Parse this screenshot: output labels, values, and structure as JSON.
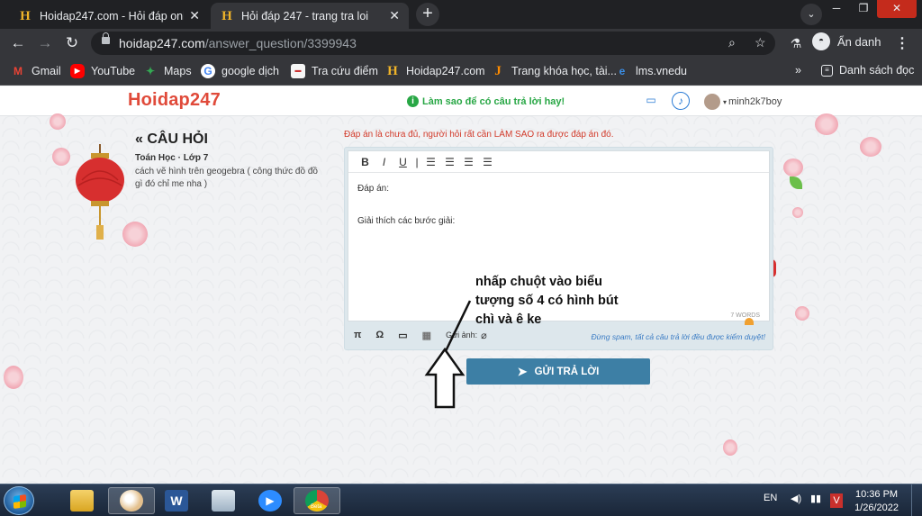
{
  "browser": {
    "tabs": [
      {
        "title": "Hoidap247.com - Hỏi đáp online",
        "active": false
      },
      {
        "title": "Hỏi đáp 247 - trang tra loi",
        "active": true
      }
    ],
    "new_tab": "+",
    "url_host": "hoidap247.com",
    "url_path": "/answer_question/3399943",
    "profile_name": "Ẩn danh",
    "bookmarks": [
      {
        "label": "Gmail",
        "icon": "gmail-icon",
        "color": "#ea4335"
      },
      {
        "label": "YouTube",
        "icon": "youtube-icon",
        "color": "#ff0000"
      },
      {
        "label": "Maps",
        "icon": "maps-icon",
        "color": "#34a853"
      },
      {
        "label": "google dịch",
        "icon": "google-icon",
        "color": "#4285f4"
      },
      {
        "label": "Tra cứu điểm",
        "icon": "tracuu-icon",
        "color": "#f6f6f6"
      },
      {
        "label": "Hoidap247.com",
        "icon": "hoidap-icon",
        "color": "#f0b429"
      },
      {
        "label": "Trang khóa học, tài...",
        "icon": "j-icon",
        "color": "#ff8c00"
      },
      {
        "label": "lms.vnedu",
        "icon": "edge-icon",
        "color": "#3a8ee6"
      }
    ],
    "more_bookmarks": "»",
    "reading_list": "Danh sách đọc"
  },
  "site": {
    "logo": "Hoidap247",
    "tip": "Làm sao để có câu trả lời hay!",
    "username": "minh2k7boy"
  },
  "question": {
    "heading": "« CÂU HỎI",
    "subject": "Toán Học · Lớp 7",
    "text": "cách vẽ hình trên geogebra ( công thức đồ đồ gì đó chỉ me nha )"
  },
  "answer": {
    "warning": "Đáp án là chưa đủ, người hỏi rất cần LÀM SAO ra được đáp án đó.",
    "toolbar": [
      "B",
      "I",
      "U"
    ],
    "line1": "Đáp án:",
    "line2": "Giải thích các bước giải:",
    "words": "7 WORDS",
    "tools": [
      "π",
      "Ω",
      "▭",
      "▦"
    ],
    "attach_label": "Gửi ảnh:",
    "note": "Đừng spam, tất cả câu trả lời đều được kiểm duyệt!",
    "submit": "GỬI TRẢ LỜI"
  },
  "annotation": "nhấp chuột vào biểu tượng số 4 có hình bút chì và ê ke",
  "taskbar": {
    "lang": "EN",
    "time": "10:36 PM",
    "date": "1/26/2022",
    "chrome_badge": "Beta"
  }
}
